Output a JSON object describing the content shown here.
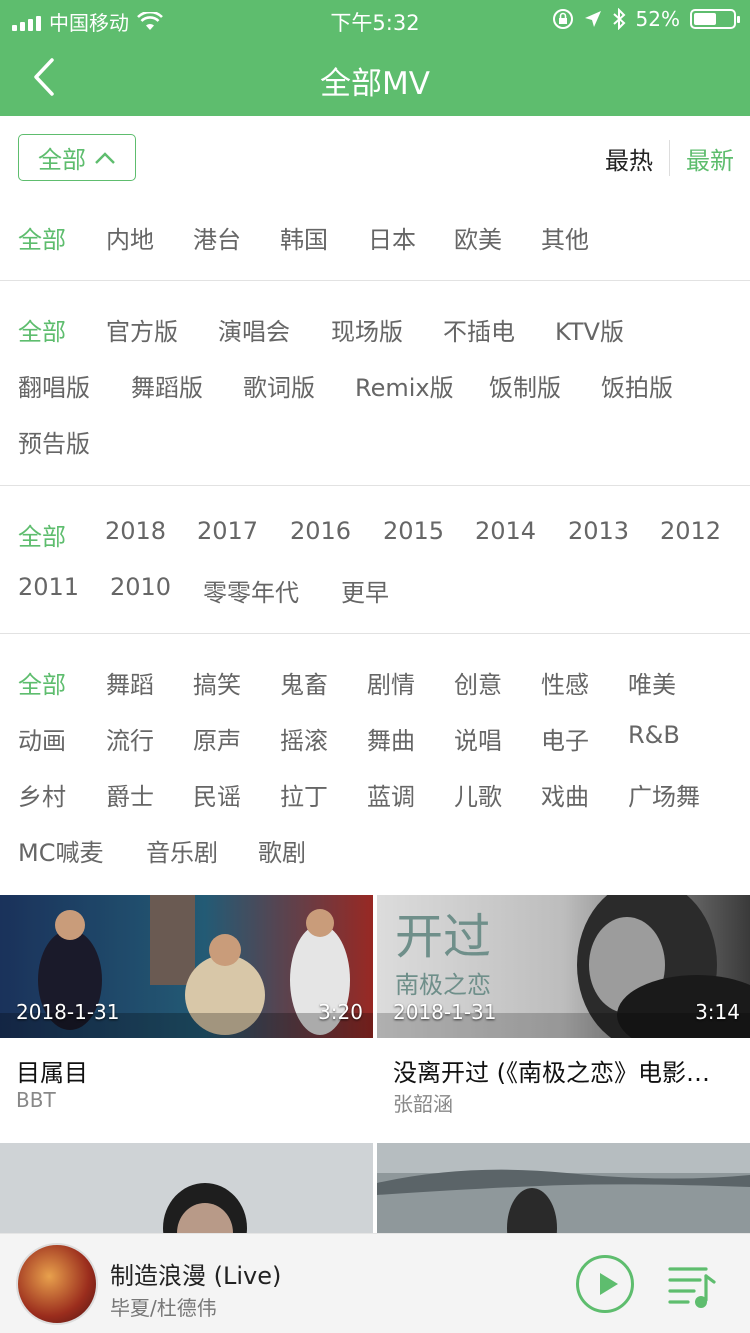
{
  "status": {
    "carrier": "中国移动",
    "time": "下午5:32",
    "battery": "52%"
  },
  "nav": {
    "title": "全部MV"
  },
  "sort": {
    "dropdown_label": "全部",
    "hot": "最热",
    "new": "最新",
    "selected": "最新"
  },
  "filters": {
    "region": [
      "全部",
      "内地",
      "港台",
      "韩国",
      "日本",
      "欧美",
      "其他"
    ],
    "version": [
      "全部",
      "官方版",
      "演唱会",
      "现场版",
      "不插电",
      "KTV版",
      "翻唱版",
      "舞蹈版",
      "歌词版",
      "Remix版",
      "饭制版",
      "饭拍版",
      "预告版"
    ],
    "year": [
      "全部",
      "2018",
      "2017",
      "2016",
      "2015",
      "2014",
      "2013",
      "2012",
      "2011",
      "2010",
      "零零年代",
      "更早"
    ],
    "style": [
      "全部",
      "舞蹈",
      "搞笑",
      "鬼畜",
      "剧情",
      "创意",
      "性感",
      "唯美",
      "动画",
      "流行",
      "原声",
      "摇滚",
      "舞曲",
      "说唱",
      "电子",
      "R&B",
      "乡村",
      "爵士",
      "民谣",
      "拉丁",
      "蓝调",
      "儿歌",
      "戏曲",
      "广场舞",
      "MC喊麦",
      "音乐剧",
      "歌剧"
    ]
  },
  "mvs": [
    {
      "date": "2018-1-31",
      "duration": "3:20",
      "title": "目属目",
      "artist": "BBT"
    },
    {
      "date": "2018-1-31",
      "duration": "3:14",
      "title": "没离开过 (《南极之恋》电影…",
      "artist": "张韶涵",
      "poster_text": "开过",
      "poster_sub": "南极之恋"
    }
  ],
  "player": {
    "title": "制造浪漫 (Live)",
    "artist": "毕夏/杜德伟"
  },
  "colors": {
    "accent": "#5ebd6e",
    "text_inactive": "#666666"
  }
}
